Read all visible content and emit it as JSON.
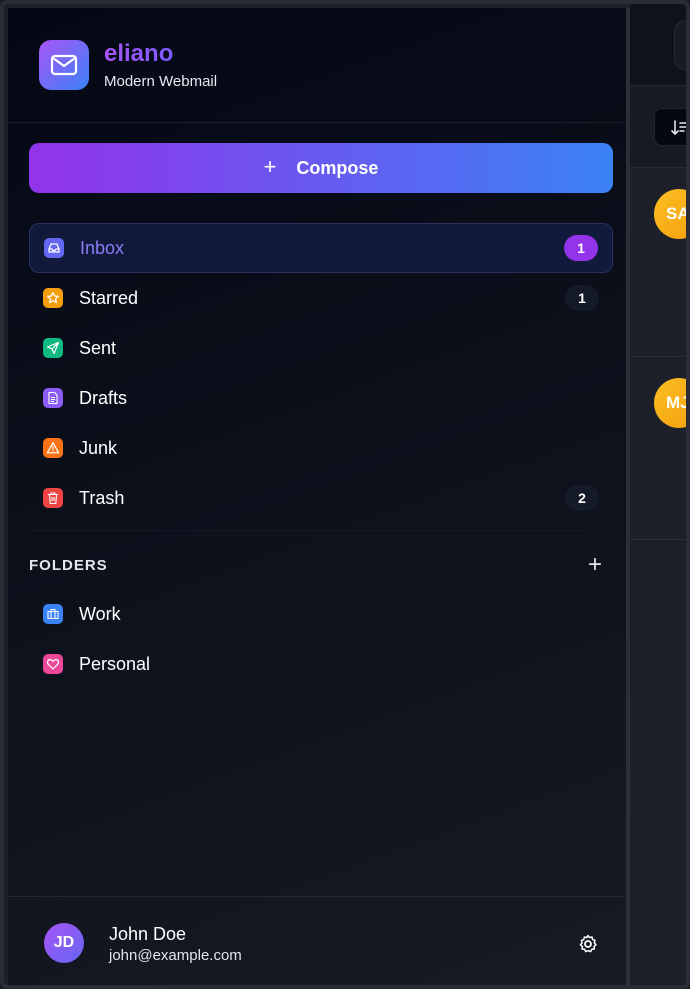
{
  "app": {
    "name": "eliano",
    "tagline": "Modern Webmail"
  },
  "compose": {
    "label": "Compose"
  },
  "nav": [
    {
      "key": "inbox",
      "label": "Inbox",
      "count": "1",
      "icon": "inbox-icon",
      "color": "#6366f1",
      "active": true
    },
    {
      "key": "starred",
      "label": "Starred",
      "count": "1",
      "icon": "star-icon",
      "color": "#f59e0b"
    },
    {
      "key": "sent",
      "label": "Sent",
      "count": "",
      "icon": "send-icon",
      "color": "#10b981"
    },
    {
      "key": "drafts",
      "label": "Drafts",
      "count": "",
      "icon": "document-icon",
      "color": "#8b5cf6"
    },
    {
      "key": "junk",
      "label": "Junk",
      "count": "",
      "icon": "warning-icon",
      "color": "#f97316"
    },
    {
      "key": "trash",
      "label": "Trash",
      "count": "2",
      "icon": "trash-icon",
      "color": "#ef4444"
    }
  ],
  "folders": {
    "title": "FOLDERS",
    "items": [
      {
        "key": "work",
        "label": "Work",
        "icon": "briefcase-icon",
        "color": "#3b82f6"
      },
      {
        "key": "personal",
        "label": "Personal",
        "icon": "heart-icon",
        "color": "#ec4899"
      }
    ]
  },
  "user": {
    "initials": "JD",
    "name": "John Doe",
    "email": "john@example.com"
  },
  "mail_list": {
    "avatars": [
      "SA",
      "MJ"
    ]
  },
  "colors": {
    "accent_purple": "#9333ea",
    "accent_blue": "#3b82f6",
    "sidebar_bg": "#0b0f1a"
  }
}
